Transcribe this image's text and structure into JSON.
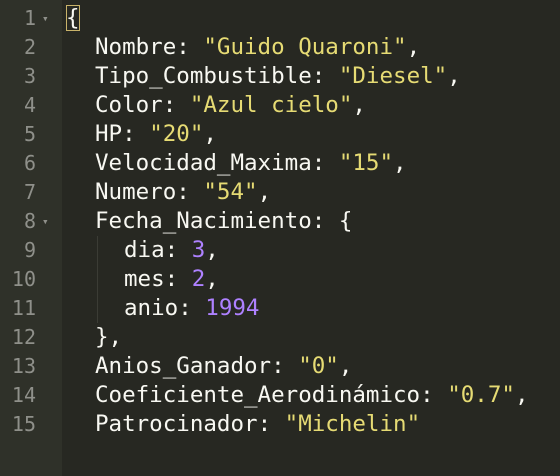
{
  "editor": {
    "fold_glyph": "▾",
    "lines": [
      {
        "num": "1",
        "indent": 0,
        "parts": [
          {
            "t": "{",
            "c": "punct",
            "hl": true
          }
        ],
        "fold": true
      },
      {
        "num": "2",
        "indent": 1,
        "parts": [
          {
            "t": "Nombre",
            "c": "key"
          },
          {
            "t": ": ",
            "c": "punct"
          },
          {
            "t": "\"Guido Quaroni\"",
            "c": "str"
          },
          {
            "t": ",",
            "c": "punct"
          }
        ]
      },
      {
        "num": "3",
        "indent": 1,
        "parts": [
          {
            "t": "Tipo_Combustible",
            "c": "key"
          },
          {
            "t": ": ",
            "c": "punct"
          },
          {
            "t": "\"Diesel\"",
            "c": "str"
          },
          {
            "t": ",",
            "c": "punct"
          }
        ]
      },
      {
        "num": "4",
        "indent": 1,
        "parts": [
          {
            "t": "Color",
            "c": "key"
          },
          {
            "t": ": ",
            "c": "punct"
          },
          {
            "t": "\"Azul cielo\"",
            "c": "str"
          },
          {
            "t": ",",
            "c": "punct"
          }
        ]
      },
      {
        "num": "5",
        "indent": 1,
        "parts": [
          {
            "t": "HP",
            "c": "key"
          },
          {
            "t": ": ",
            "c": "punct"
          },
          {
            "t": "\"20\"",
            "c": "str"
          },
          {
            "t": ",",
            "c": "punct"
          }
        ]
      },
      {
        "num": "6",
        "indent": 1,
        "parts": [
          {
            "t": "Velocidad_Maxima",
            "c": "key"
          },
          {
            "t": ": ",
            "c": "punct"
          },
          {
            "t": "\"15\"",
            "c": "str"
          },
          {
            "t": ",",
            "c": "punct"
          }
        ]
      },
      {
        "num": "7",
        "indent": 1,
        "parts": [
          {
            "t": "Numero",
            "c": "key"
          },
          {
            "t": ": ",
            "c": "punct"
          },
          {
            "t": "\"54\"",
            "c": "str"
          },
          {
            "t": ",",
            "c": "punct"
          }
        ]
      },
      {
        "num": "8",
        "indent": 1,
        "parts": [
          {
            "t": "Fecha_Nacimiento",
            "c": "key"
          },
          {
            "t": ": {",
            "c": "punct"
          }
        ],
        "fold": true
      },
      {
        "num": "9",
        "indent": 2,
        "parts": [
          {
            "t": "dia",
            "c": "key"
          },
          {
            "t": ": ",
            "c": "punct"
          },
          {
            "t": "3",
            "c": "num"
          },
          {
            "t": ",",
            "c": "punct"
          }
        ]
      },
      {
        "num": "10",
        "indent": 2,
        "parts": [
          {
            "t": "mes",
            "c": "key"
          },
          {
            "t": ": ",
            "c": "punct"
          },
          {
            "t": "2",
            "c": "num"
          },
          {
            "t": ",",
            "c": "punct"
          }
        ]
      },
      {
        "num": "11",
        "indent": 2,
        "parts": [
          {
            "t": "anio",
            "c": "key"
          },
          {
            "t": ": ",
            "c": "punct"
          },
          {
            "t": "1994",
            "c": "num"
          }
        ]
      },
      {
        "num": "12",
        "indent": 1,
        "parts": [
          {
            "t": "},",
            "c": "punct"
          }
        ]
      },
      {
        "num": "13",
        "indent": 1,
        "parts": [
          {
            "t": "Anios_Ganador",
            "c": "key"
          },
          {
            "t": ": ",
            "c": "punct"
          },
          {
            "t": "\"0\"",
            "c": "str"
          },
          {
            "t": ",",
            "c": "punct"
          }
        ]
      },
      {
        "num": "14",
        "indent": 1,
        "parts": [
          {
            "t": "Coeficiente_Aerodinámico",
            "c": "key"
          },
          {
            "t": ": ",
            "c": "punct"
          },
          {
            "t": "\"0.7\"",
            "c": "str"
          },
          {
            "t": ",",
            "c": "punct"
          }
        ]
      },
      {
        "num": "15",
        "indent": 1,
        "parts": [
          {
            "t": "Patrocinador",
            "c": "key"
          },
          {
            "t": ": ",
            "c": "punct"
          },
          {
            "t": "\"Michelin\"",
            "c": "str"
          }
        ]
      }
    ]
  }
}
